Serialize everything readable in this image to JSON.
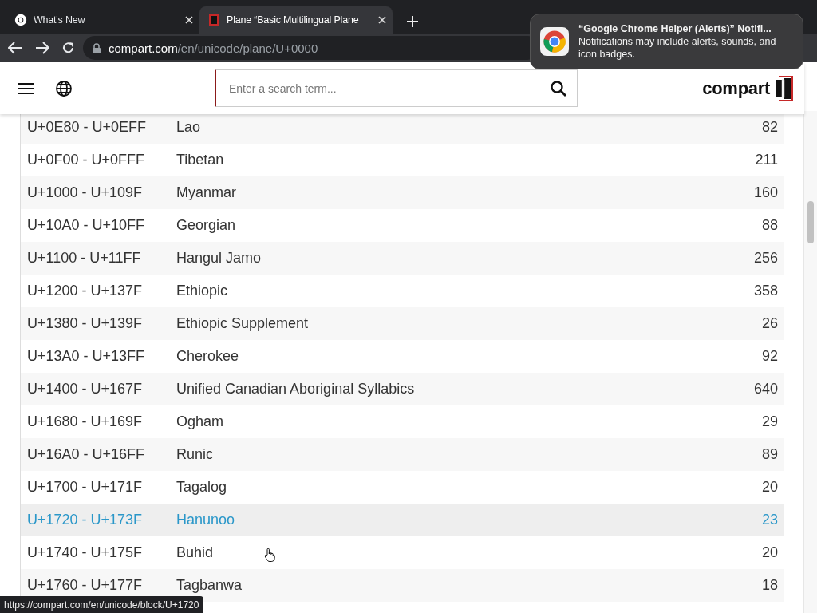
{
  "browser": {
    "tabs": [
      {
        "title": "What's New",
        "selected": false
      },
      {
        "title": "Plane “Basic Multilingual Plane",
        "selected": true
      }
    ],
    "address": {
      "domain": "compart.com",
      "path": "/en/unicode/plane/U+0000"
    }
  },
  "header": {
    "search": {
      "placeholder": "Enter a search term..."
    },
    "logo": "compart"
  },
  "blocks": [
    {
      "range": "U+0E80 - U+0EFF",
      "name": "Lao",
      "count": "82",
      "hovered": false
    },
    {
      "range": "U+0F00 - U+0FFF",
      "name": "Tibetan",
      "count": "211",
      "hovered": false
    },
    {
      "range": "U+1000 - U+109F",
      "name": "Myanmar",
      "count": "160",
      "hovered": false
    },
    {
      "range": "U+10A0 - U+10FF",
      "name": "Georgian",
      "count": "88",
      "hovered": false
    },
    {
      "range": "U+1100 - U+11FF",
      "name": "Hangul Jamo",
      "count": "256",
      "hovered": false
    },
    {
      "range": "U+1200 - U+137F",
      "name": "Ethiopic",
      "count": "358",
      "hovered": false
    },
    {
      "range": "U+1380 - U+139F",
      "name": "Ethiopic Supplement",
      "count": "26",
      "hovered": false
    },
    {
      "range": "U+13A0 - U+13FF",
      "name": "Cherokee",
      "count": "92",
      "hovered": false
    },
    {
      "range": "U+1400 - U+167F",
      "name": "Unified Canadian Aboriginal Syllabics",
      "count": "640",
      "hovered": false
    },
    {
      "range": "U+1680 - U+169F",
      "name": "Ogham",
      "count": "29",
      "hovered": false
    },
    {
      "range": "U+16A0 - U+16FF",
      "name": "Runic",
      "count": "89",
      "hovered": false
    },
    {
      "range": "U+1700 - U+171F",
      "name": "Tagalog",
      "count": "20",
      "hovered": false
    },
    {
      "range": "U+1720 - U+173F",
      "name": "Hanunoo",
      "count": "23",
      "hovered": true
    },
    {
      "range": "U+1740 - U+175F",
      "name": "Buhid",
      "count": "20",
      "hovered": false
    },
    {
      "range": "U+1760 - U+177F",
      "name": "Tagbanwa",
      "count": "18",
      "hovered": false
    }
  ],
  "notification": {
    "title": "“Google Chrome Helper (Alerts)” Notifi...",
    "body": "Notifications may include alerts, sounds, and icon badges."
  },
  "status_url": "https://compart.com/en/unicode/block/U+1720"
}
